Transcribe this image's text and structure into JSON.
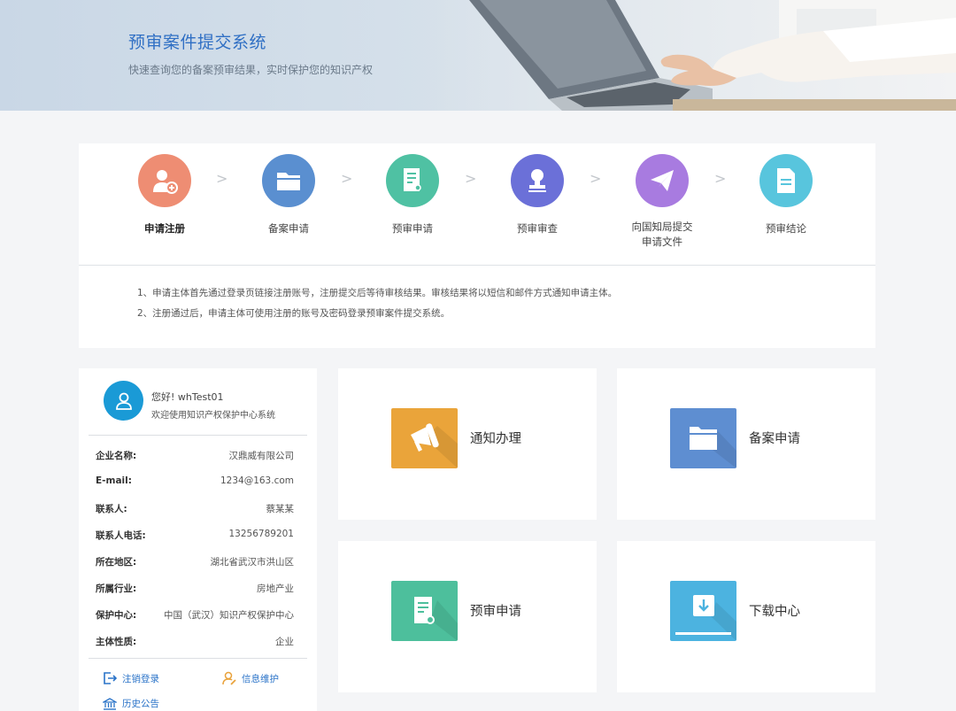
{
  "header": {
    "title": "预审案件提交系统",
    "subtitle": "快速查询您的备案预审结果，实时保护您的知识产权"
  },
  "steps": [
    {
      "label": "申请注册",
      "icon": "user-add-icon",
      "color": "#ee8d73"
    },
    {
      "label": "备案申请",
      "icon": "folder-icon",
      "color": "#5a8fd0"
    },
    {
      "label": "预审申请",
      "icon": "document-icon",
      "color": "#4fc1a3"
    },
    {
      "label": "预审审查",
      "icon": "stamp-icon",
      "color": "#6b70d8"
    },
    {
      "label": "向国知局提交申请文件",
      "icon": "paper-plane-icon",
      "color": "#a87be0"
    },
    {
      "label": "预审结论",
      "icon": "file-text-icon",
      "color": "#58c5dd"
    }
  ],
  "step_separator": ">",
  "notes": [
    "1、申请主体首先通过登录页链接注册账号，注册提交后等待审核结果。审核结果将以短信和邮件方式通知申请主体。",
    "2、注册通过后，申请主体可使用注册的账号及密码登录预审案件提交系统。"
  ],
  "user": {
    "greeting": "您好! whTest01",
    "welcome": "欢迎使用知识产权保护中心系统",
    "info": [
      {
        "key": "企业名称:",
        "value": "汉鼎威有限公司"
      },
      {
        "key": "E-mail:",
        "value": "1234@163.com"
      },
      {
        "key": "联系人:",
        "value": "蔡某某"
      },
      {
        "key": "联系人电话:",
        "value": "13256789201"
      },
      {
        "key": "所在地区:",
        "value": "湖北省武汉市洪山区"
      },
      {
        "key": "所属行业:",
        "value": "房地产业"
      },
      {
        "key": "保护中心:",
        "value": "中国（武汉）知识产权保护中心"
      },
      {
        "key": "主体性质:",
        "value": "企业"
      }
    ],
    "links": {
      "logout": "注销登录",
      "info_maintain": "信息维护",
      "history": "历史公告"
    }
  },
  "tiles": [
    {
      "label": "通知办理",
      "icon": "megaphone-icon",
      "color": "#eaa43a"
    },
    {
      "label": "备案申请",
      "icon": "folder-icon",
      "color": "#5e8ed1"
    },
    {
      "label": "预审申请",
      "icon": "document-icon",
      "color": "#4dbf9c"
    },
    {
      "label": "下载中心",
      "icon": "download-icon",
      "color": "#4cb3e0"
    }
  ],
  "colors": {
    "accent": "#2f6fc4",
    "avatar": "#1a9ad6",
    "link": "#2a73c8",
    "page_bg": "#f4f5f7"
  }
}
